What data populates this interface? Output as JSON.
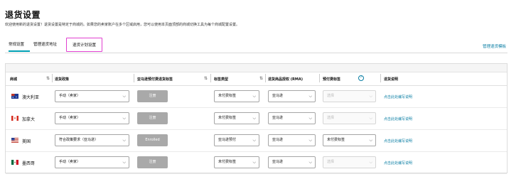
{
  "page": {
    "title": "退货设置",
    "subtitle": "欢迎使用新的退货设置！退货设置是特定于商城的。如果您的卖家账户在多个区域启用，您可以使用本页面顶部的商城切换工具为每个商城配置设置。"
  },
  "tabs": [
    {
      "label": "常规设置",
      "active": true
    },
    {
      "label": "管理退货地址",
      "active": false
    },
    {
      "label": "退货计划设置",
      "active": false,
      "highlighted": true
    }
  ],
  "manage_link": "管理退货模板",
  "table": {
    "headers": {
      "country": "商城",
      "policy": "退货政策",
      "enroll": "亚马逊预付费退货标签",
      "label_type": "标签类型",
      "rma": "退货商品授权 (RMA)",
      "seller_label": "预付费标签",
      "desc": "退货说明"
    },
    "rows": [
      {
        "country": "澳大利亚",
        "flag": "au",
        "policy": "手动（卖家）",
        "enroll": "注册",
        "label_type": "未付费标签",
        "rma": "亚马逊",
        "seller_label": "选择",
        "seller_disabled": true,
        "desc": "点击此处编写说明"
      },
      {
        "country": "加拿大",
        "flag": "ca",
        "policy": "手动（卖家）",
        "enroll": "注册",
        "label_type": "未付费标签",
        "rma": "亚马逊",
        "seller_label": "选择",
        "seller_disabled": true,
        "desc": "点击此处编写说明"
      },
      {
        "country": "美国",
        "flag": "us",
        "policy": "符合政策要求（亚马逊）",
        "enroll": "Enrolled",
        "label_type": "亚马逊预付",
        "rma": "亚马逊",
        "seller_label": "未付费标签",
        "seller_disabled": false,
        "desc": "点击此处编写说明"
      },
      {
        "country": "墨西哥",
        "flag": "mx",
        "policy": "手动（卖家）",
        "enroll": "注册",
        "label_type": "未付费标签",
        "rma": "亚马逊",
        "seller_label": "选择",
        "seller_disabled": true,
        "desc": "点击此处编写说明"
      }
    ]
  }
}
